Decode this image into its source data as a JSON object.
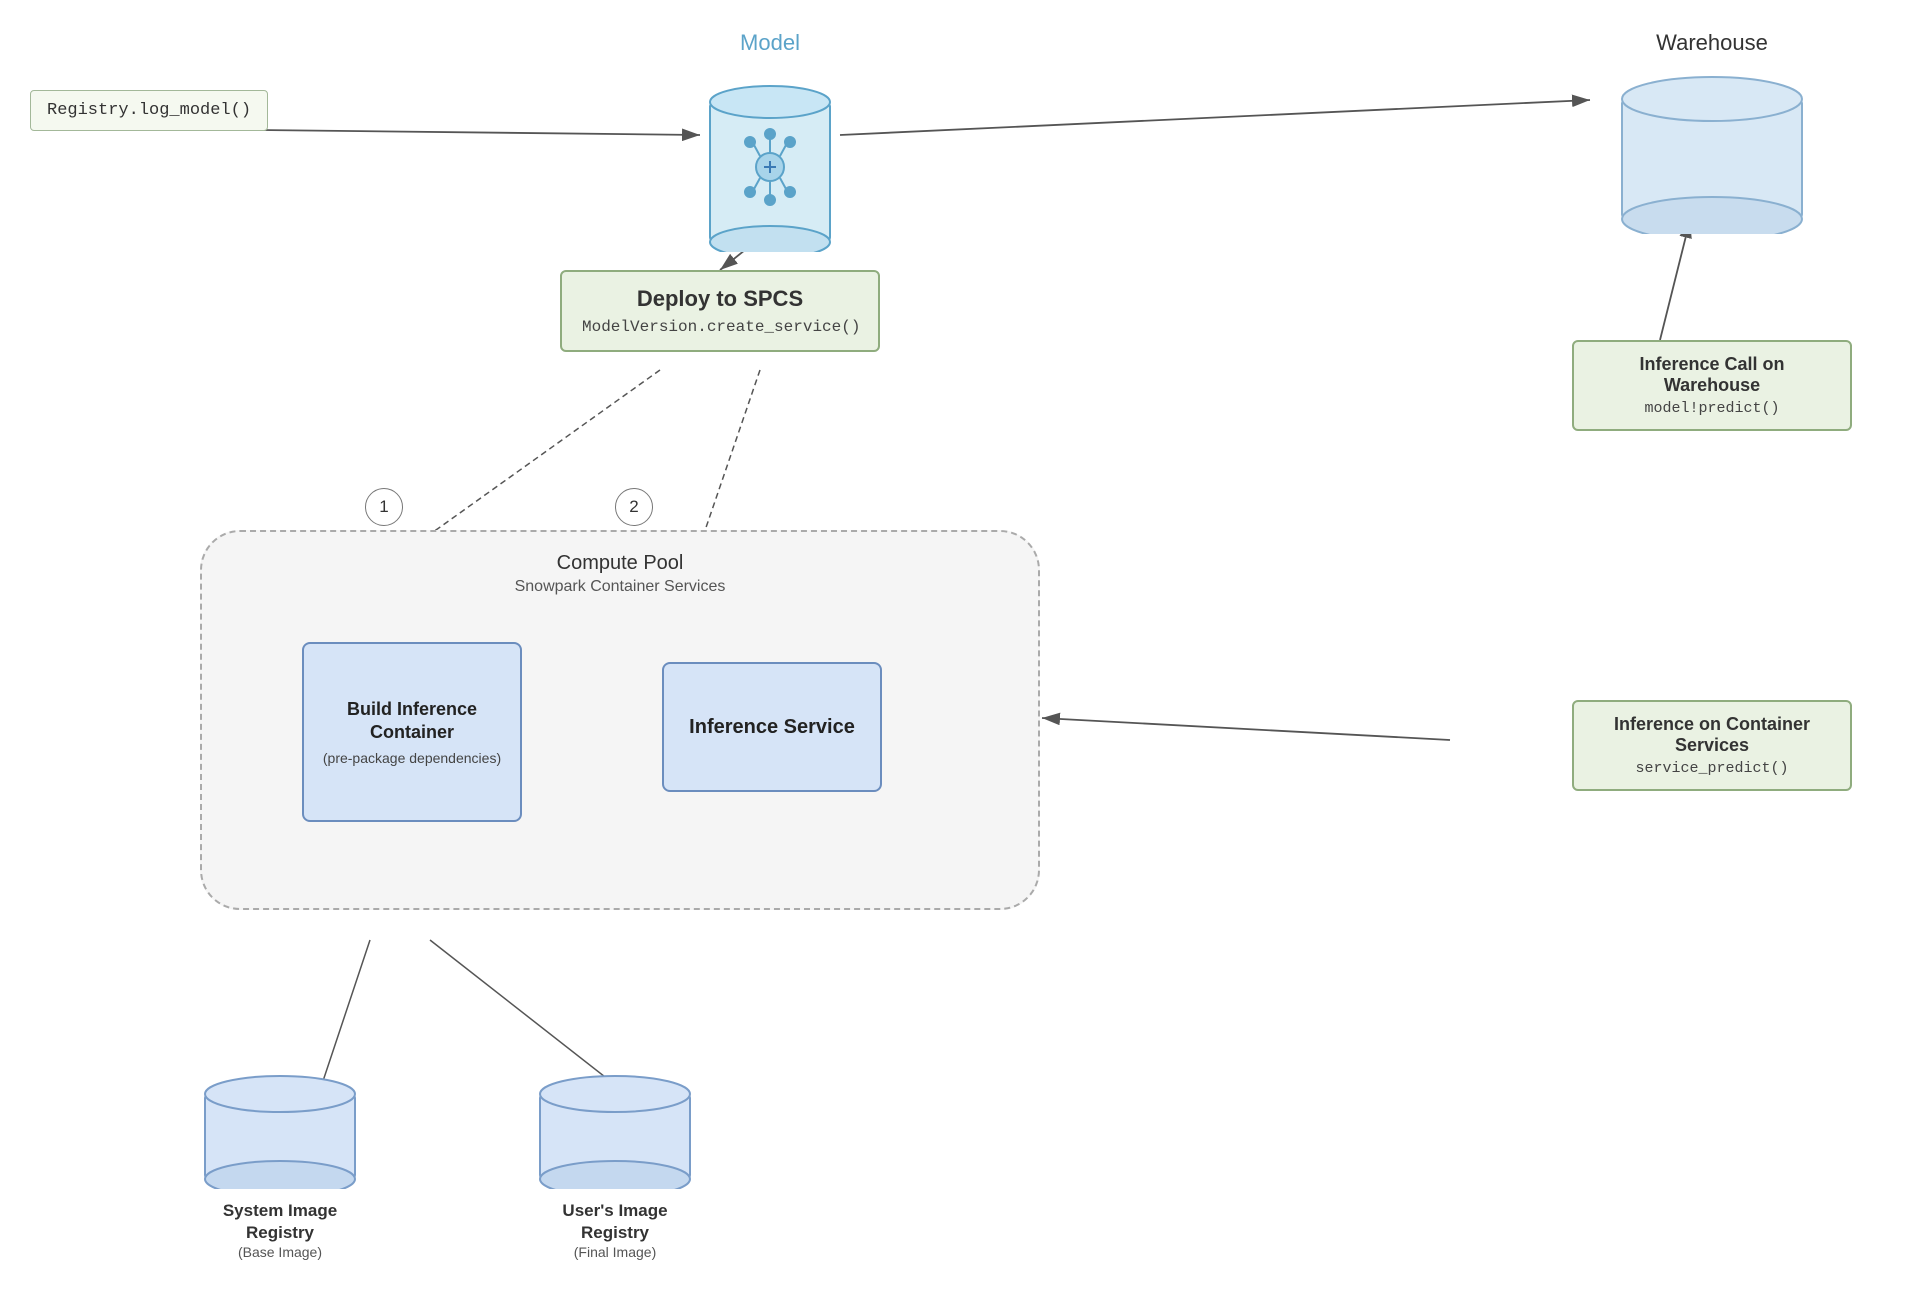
{
  "model": {
    "label": "Model"
  },
  "registry_box": {
    "code": "Registry.log_model()"
  },
  "warehouse": {
    "label": "Warehouse"
  },
  "deploy_box": {
    "title": "Deploy to SPCS",
    "code": "ModelVersion.create_service()"
  },
  "inference_warehouse": {
    "title": "Inference Call on Warehouse",
    "code": "model!predict()"
  },
  "compute_pool": {
    "title": "Compute Pool",
    "subtitle": "Snowpark Container Services"
  },
  "build_inference": {
    "title": "Build Inference Container",
    "subtitle": "(pre-package dependencies)"
  },
  "inference_service": {
    "title": "Inference Service"
  },
  "inference_container": {
    "title": "Inference on Container Services",
    "code": "service_predict()"
  },
  "step1": {
    "label": "1"
  },
  "step2": {
    "label": "2"
  },
  "sys_registry": {
    "label": "System Image Registry",
    "sub": "(Base Image)"
  },
  "user_registry": {
    "label": "User's Image Registry",
    "sub": "(Final Image)"
  }
}
